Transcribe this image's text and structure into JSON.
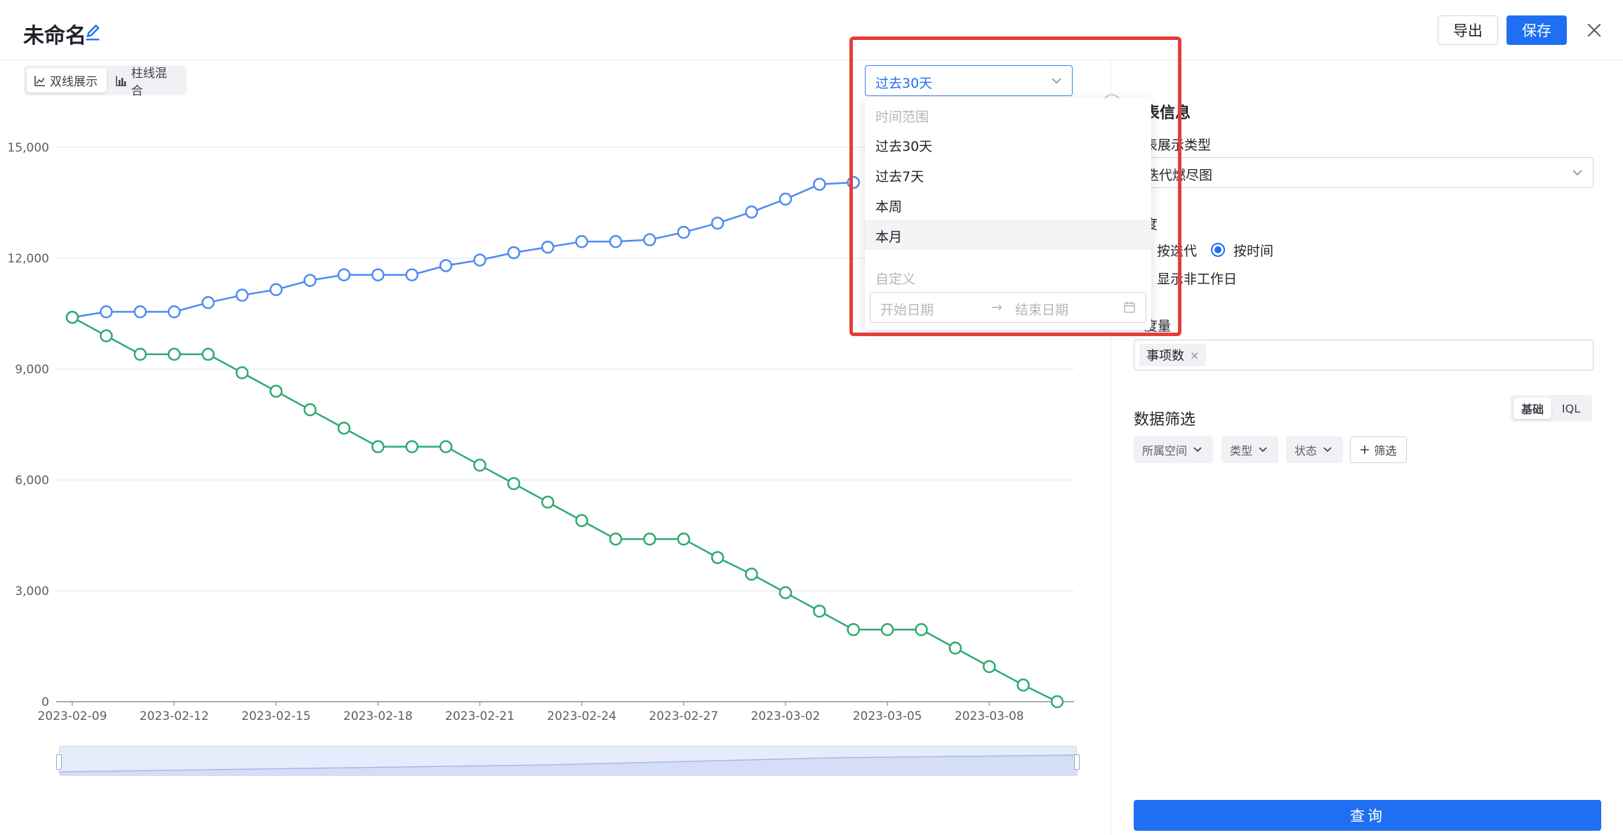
{
  "header": {
    "title": "未命名",
    "export_label": "导出",
    "save_label": "保存"
  },
  "view_toggle": {
    "items": [
      {
        "label": "双线展示",
        "active": true
      },
      {
        "label": "柱线混合",
        "active": false
      }
    ]
  },
  "range_select": {
    "value": "过去30天",
    "dropdown": {
      "group_time": "时间范围",
      "options": [
        "过去30天",
        "过去7天",
        "本周",
        "本月"
      ],
      "hovered": "本月",
      "group_custom": "自定义",
      "start_placeholder": "开始日期",
      "arrow": "→",
      "end_placeholder": "结束日期"
    }
  },
  "panel": {
    "section_info": "表信息",
    "chart_type_label": "表展示类型",
    "chart_type_value": "迭代燃尽图",
    "dimension_label": "度",
    "radio_iteration": "按迭代",
    "radio_time": "按时间",
    "show_nonwork": "显示非工作日",
    "measure_label": "度量",
    "measure_tag": "事项数",
    "filter_title": "数据筛选",
    "mode_basic": "基础",
    "mode_iql": "IQL",
    "filters": [
      "所属空间",
      "类型",
      "状态"
    ],
    "add_filter": "筛选",
    "query": "查询"
  },
  "colors": {
    "accent": "#1f6ff2",
    "series_blue": "#4e8cf0",
    "series_green": "#2eaa72",
    "highlight": "#e53e3a"
  },
  "chart_data": {
    "type": "line",
    "x": [
      "2023-02-09",
      "2023-02-10",
      "2023-02-11",
      "2023-02-12",
      "2023-02-13",
      "2023-02-14",
      "2023-02-15",
      "2023-02-16",
      "2023-02-17",
      "2023-02-18",
      "2023-02-19",
      "2023-02-20",
      "2023-02-21",
      "2023-02-22",
      "2023-02-23",
      "2023-02-24",
      "2023-02-25",
      "2023-02-26",
      "2023-02-27",
      "2023-02-28",
      "2023-03-01",
      "2023-03-02",
      "2023-03-03",
      "2023-03-04",
      "2023-03-05",
      "2023-03-06",
      "2023-03-07",
      "2023-03-08",
      "2023-03-09",
      "2023-03-10"
    ],
    "x_ticks": [
      "2023-02-09",
      "2023-02-12",
      "2023-02-15",
      "2023-02-18",
      "2023-02-21",
      "2023-02-24",
      "2023-02-27",
      "2023-03-02",
      "2023-03-05",
      "2023-03-08"
    ],
    "y_ticks": [
      "0",
      "3,000",
      "6,000",
      "9,000",
      "12,000",
      "15,000"
    ],
    "ylim": [
      0,
      15000
    ],
    "series": [
      {
        "color": "#4e8cf0",
        "values": [
          10400,
          10550,
          10550,
          10550,
          10800,
          11000,
          11150,
          11400,
          11550,
          11550,
          11550,
          11800,
          11950,
          12150,
          12300,
          12450,
          12450,
          12500,
          12700,
          12950,
          13250,
          13600,
          14000,
          14050,
          null,
          null,
          null,
          null,
          null,
          null
        ]
      },
      {
        "color": "#2eaa72",
        "values": [
          10400,
          9900,
          9400,
          9400,
          9400,
          8900,
          8400,
          7900,
          7400,
          6900,
          6900,
          6900,
          6400,
          5900,
          5400,
          4900,
          4400,
          4400,
          4400,
          3900,
          3450,
          2950,
          2450,
          1950,
          1950,
          1950,
          1450,
          950,
          450,
          0
        ]
      }
    ]
  }
}
